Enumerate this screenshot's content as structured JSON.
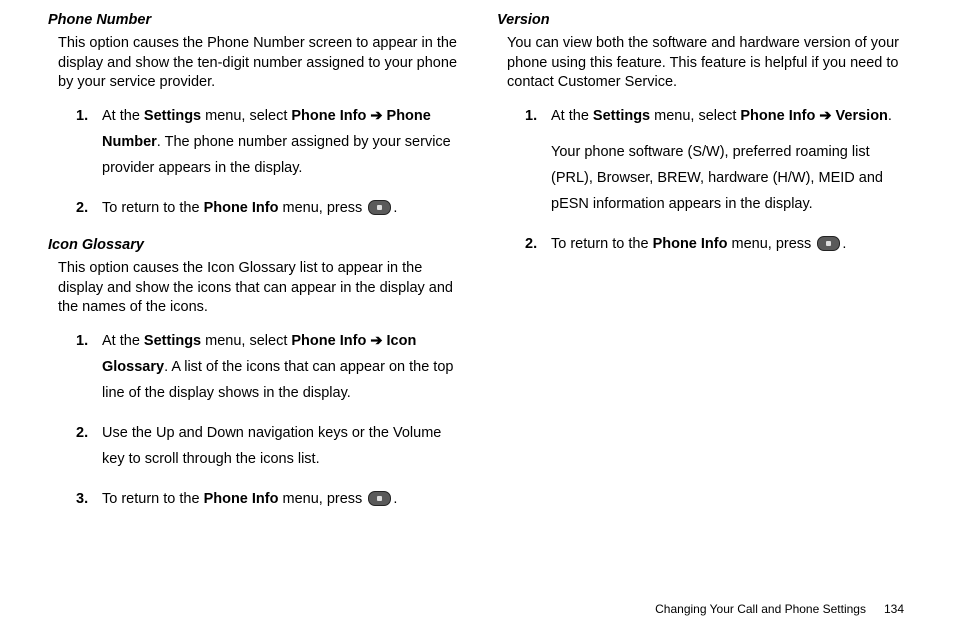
{
  "left": {
    "phoneNumber": {
      "heading": "Phone Number",
      "intro": "This option causes the Phone Number screen to appear in the display and show the ten-digit number assigned to your phone by your service provider.",
      "step1": {
        "num": "1.",
        "pre": "At the ",
        "settings": "Settings",
        "mid1": " menu, select ",
        "phoneInfo": "Phone Info",
        "arrow": " ➔ ",
        "target": "Phone Number",
        "post": ". The phone number assigned by your service provider appears in the display."
      },
      "step2": {
        "num": "2.",
        "pre": "To return to the ",
        "phoneInfo": "Phone Info",
        "mid": " menu, press ",
        "post": "."
      }
    },
    "iconGlossary": {
      "heading": "Icon Glossary",
      "intro": "This option causes the Icon Glossary list to appear in the display and show the icons that can appear in the display and the names of the icons.",
      "step1": {
        "num": "1.",
        "pre": "At the ",
        "settings": "Settings",
        "mid1": " menu, select ",
        "phoneInfo": "Phone Info",
        "arrow": " ➔  ",
        "target": "Icon Glossary",
        "post": ". A list of the icons that can appear on the top line of the display shows in the display."
      },
      "step2": {
        "num": "2.",
        "text": "Use the Up and Down navigation keys or the Volume key to scroll through the icons list."
      },
      "step3": {
        "num": "3.",
        "pre": "To return to the ",
        "phoneInfo": "Phone Info",
        "mid": " menu, press ",
        "post": "."
      }
    }
  },
  "right": {
    "version": {
      "heading": "Version",
      "intro": "You can view both the software and hardware version of your phone using this feature. This feature is helpful if you need to contact Customer Service.",
      "step1": {
        "num": "1.",
        "pre": "At the ",
        "settings": "Settings",
        "mid1": " menu, select ",
        "phoneInfo": "Phone Info",
        "arrow": " ➔ ",
        "target": "Version",
        "post1": ".",
        "line2": "Your phone software (S/W), preferred roaming list (PRL), Browser, BREW, hardware (H/W), MEID and pESN information appears in the display."
      },
      "step2": {
        "num": "2.",
        "pre": "To return to the ",
        "phoneInfo": "Phone Info",
        "mid": " menu, press ",
        "post": "."
      }
    }
  },
  "footer": {
    "chapter": "Changing Your Call and Phone Settings",
    "page": "134"
  }
}
